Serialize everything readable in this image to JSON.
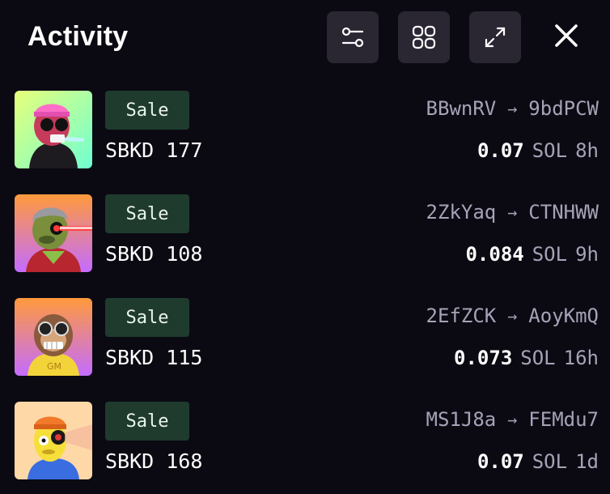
{
  "header": {
    "title": "Activity",
    "filter_icon": "sliders-icon",
    "grid_icon": "grid-icon",
    "expand_icon": "expand-icon",
    "close_icon": "close-icon"
  },
  "colors": {
    "background": "#0b0a12",
    "icon_button_bg": "#2a2733",
    "badge_bg": "#1f3b2e",
    "muted_text": "#a7a2b8"
  },
  "activity": [
    {
      "type": "Sale",
      "name": "SBKD 177",
      "from": "BBwnRV",
      "to": "9bdPCW",
      "price": "0.07",
      "currency": "SOL",
      "time": "8h"
    },
    {
      "type": "Sale",
      "name": "SBKD 108",
      "from": "2ZkYaq",
      "to": "CTNHWW",
      "price": "0.084",
      "currency": "SOL",
      "time": "9h"
    },
    {
      "type": "Sale",
      "name": "SBKD 115",
      "from": "2EfZCK",
      "to": "AoyKmQ",
      "price": "0.073",
      "currency": "SOL",
      "time": "16h"
    },
    {
      "type": "Sale",
      "name": "SBKD 168",
      "from": "MS1J8a",
      "to": "FEMdu7",
      "price": "0.07",
      "currency": "SOL",
      "time": "1d"
    }
  ]
}
